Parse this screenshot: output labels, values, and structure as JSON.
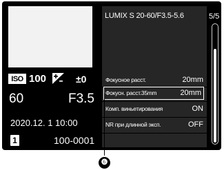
{
  "left_panel": {
    "iso_label": "ISO",
    "iso_value": "100",
    "ev_icon": "exposure-compensation-icon",
    "ev_value": "±0",
    "shutter_speed": "60",
    "aperture": "F3.5",
    "datetime": "2020.12.  1 10:00",
    "card_slot": "1",
    "file_number": "100-0001"
  },
  "detail_panel": {
    "lens_name": "LUMIX S 20-60/F3.5-5.6",
    "rows": [
      {
        "label": "Фокусное расст.",
        "value": "20mm"
      },
      {
        "label": "Фокусн. расст.35mm",
        "value": "20mm"
      },
      {
        "label": "Комп. виньетирования",
        "value": "ON"
      },
      {
        "label": "NR при длинной эксп.",
        "value": "OFF"
      }
    ]
  },
  "page_indicator": "5/5",
  "scroll_position": {
    "current_page": 5,
    "total_pages": 5
  },
  "callout_number": "❻",
  "colors": {
    "screen_bg": "#000000",
    "panel_bg": "#262626",
    "text": "#ffffff"
  }
}
